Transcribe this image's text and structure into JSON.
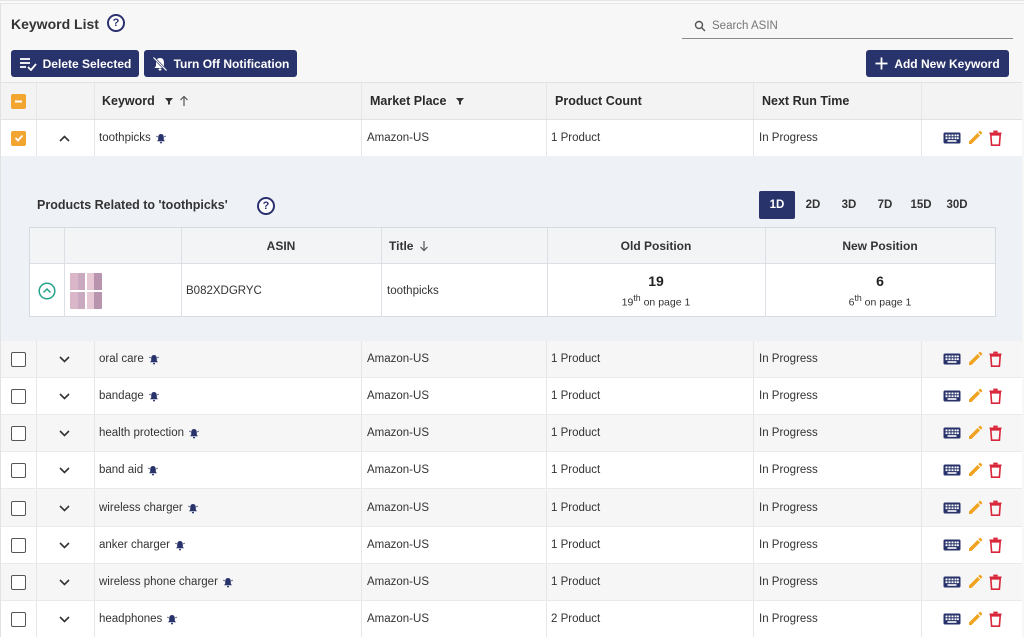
{
  "header": {
    "title": "Keyword List",
    "help_glyph": "?",
    "search_placeholder": "Search ASIN"
  },
  "toolbar": {
    "delete_label": "Delete Selected",
    "notify_label": "Turn Off Notification",
    "add_label": "Add New Keyword"
  },
  "table": {
    "columns": {
      "keyword": "Keyword",
      "marketplace": "Market Place",
      "product_count": "Product Count",
      "next_run": "Next Run Time"
    },
    "rows": [
      {
        "keyword": "toothpicks",
        "marketplace": "Amazon-US",
        "product_count": "1 Product",
        "next_run": "In Progress",
        "checked": true,
        "expanded": true
      },
      {
        "keyword": "oral care",
        "marketplace": "Amazon-US",
        "product_count": "1 Product",
        "next_run": "In Progress",
        "checked": false,
        "expanded": false
      },
      {
        "keyword": "bandage",
        "marketplace": "Amazon-US",
        "product_count": "1 Product",
        "next_run": "In Progress",
        "checked": false,
        "expanded": false
      },
      {
        "keyword": "health protection",
        "marketplace": "Amazon-US",
        "product_count": "1 Product",
        "next_run": "In Progress",
        "checked": false,
        "expanded": false
      },
      {
        "keyword": "band aid",
        "marketplace": "Amazon-US",
        "product_count": "1 Product",
        "next_run": "In Progress",
        "checked": false,
        "expanded": false
      },
      {
        "keyword": "wireless charger",
        "marketplace": "Amazon-US",
        "product_count": "1 Product",
        "next_run": "In Progress",
        "checked": false,
        "expanded": false
      },
      {
        "keyword": "anker charger",
        "marketplace": "Amazon-US",
        "product_count": "1 Product",
        "next_run": "In Progress",
        "checked": false,
        "expanded": false
      },
      {
        "keyword": "wireless phone charger",
        "marketplace": "Amazon-US",
        "product_count": "1 Product",
        "next_run": "In Progress",
        "checked": false,
        "expanded": false
      },
      {
        "keyword": "headphones",
        "marketplace": "Amazon-US",
        "product_count": "2 Product",
        "next_run": "In Progress",
        "checked": false,
        "expanded": false
      }
    ]
  },
  "related": {
    "title": "Products Related to 'toothpicks'",
    "ranges": [
      "1D",
      "2D",
      "3D",
      "7D",
      "15D",
      "30D"
    ],
    "active_range": "1D",
    "columns": {
      "asin": "ASIN",
      "title": "Title",
      "old_position": "Old Position",
      "new_position": "New Position"
    },
    "product": {
      "asin": "B082XDGRYC",
      "title": "toothpicks",
      "old_position": "19",
      "old_sup": "th",
      "old_page_text": "on page 1",
      "old_ordinal_num": "19",
      "new_position": "6",
      "new_sup": "th",
      "new_page_text": "on page 1",
      "new_ordinal_num": "6"
    }
  },
  "colors": {
    "primary": "#28336b",
    "checkbox_accent": "#f2a531",
    "edit_icon": "#f0a320",
    "delete_icon": "#d9263a",
    "expand_icon": "#22a38a"
  }
}
